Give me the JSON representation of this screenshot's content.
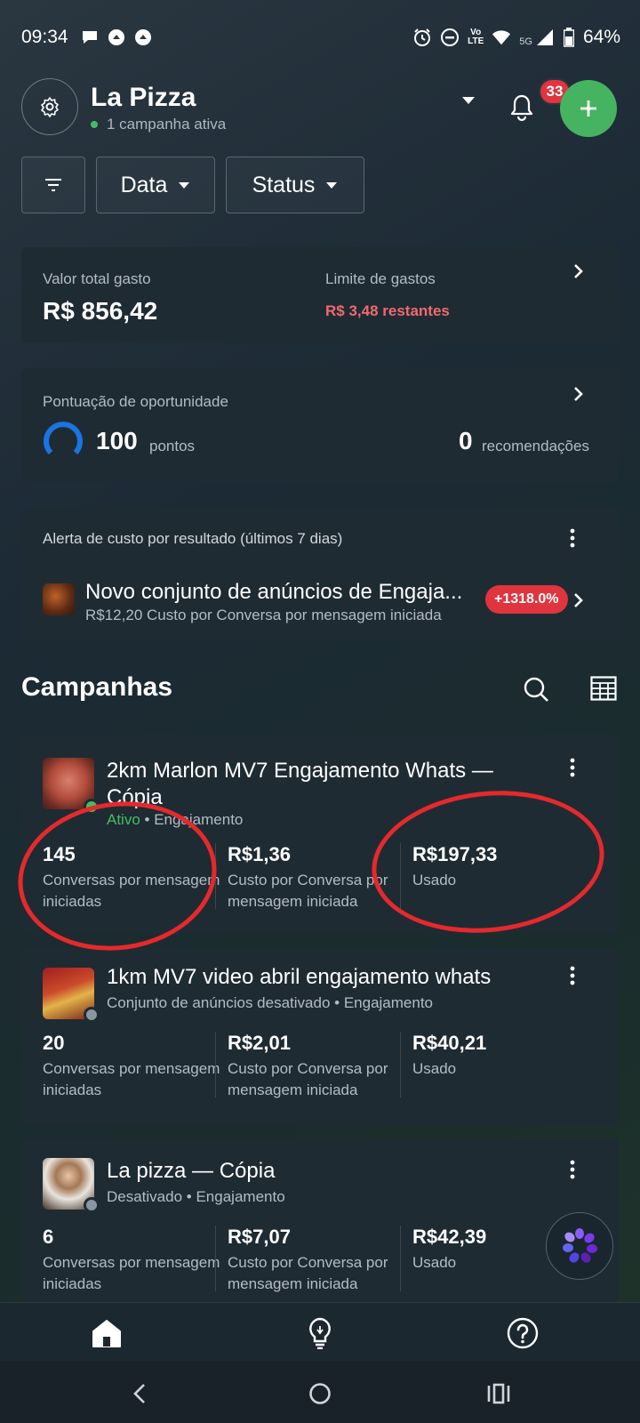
{
  "status_bar": {
    "time": "09:34",
    "battery": "64%",
    "network": "5G",
    "lte": "LTE"
  },
  "header": {
    "title": "La Pizza",
    "subtitle": "1 campanha ativa",
    "notification_count": "33"
  },
  "filters": {
    "date_label": "Data",
    "status_label": "Status"
  },
  "spend": {
    "total_label": "Valor total gasto",
    "total_value": "R$ 856,42",
    "limit_label": "Limite de gastos",
    "limit_value": "R$ 3,48 restantes"
  },
  "opportunity": {
    "label": "Pontuação de oportunidade",
    "score": "100",
    "score_unit": "pontos",
    "score_fraction": 1.0,
    "recommendations": "0",
    "recommendations_unit": "recomendações"
  },
  "alert": {
    "title": "Alerta de custo por resultado (últimos 7 dias)",
    "name": "Novo conjunto de anúncios de Engaja...",
    "meta": "R$12,20  Custo por Conversa por mensagem iniciada",
    "badge": "+1318.0%"
  },
  "campaigns_section": {
    "title": "Campanhas"
  },
  "campaigns": [
    {
      "name": "2km Marlon MV7 Engajamento Whats — Cópia",
      "status": "Ativo",
      "objective": "• Engajamento",
      "status_color": "#45bd62",
      "metrics": [
        {
          "value": "145",
          "label": "Conversas por mensagem iniciadas"
        },
        {
          "value": "R$1,36",
          "label": "Custo por Conversa por mensagem iniciada"
        },
        {
          "value": "R$197,33",
          "label": "Usado"
        }
      ]
    },
    {
      "name": "1km MV7 video abril engajamento whats",
      "status": "Conjunto de anúncios desativado",
      "objective": "• Engajamento",
      "status_color": "#8a96a0",
      "metrics": [
        {
          "value": "20",
          "label": "Conversas por mensagem iniciadas"
        },
        {
          "value": "R$2,01",
          "label": "Custo por Conversa por mensagem iniciada"
        },
        {
          "value": "R$40,21",
          "label": "Usado"
        }
      ]
    },
    {
      "name": "La pizza — Cópia",
      "status": "Desativado",
      "objective": "• Engajamento",
      "status_color": "#8a96a0",
      "metrics": [
        {
          "value": "6",
          "label": "Conversas por mensagem iniciadas"
        },
        {
          "value": "R$7,07",
          "label": "Custo por Conversa por mensagem iniciada"
        },
        {
          "value": "R$42,39",
          "label": "Usado"
        }
      ]
    }
  ],
  "colors": {
    "accent_green": "#45b35f",
    "alert_red": "#e0343f",
    "annotation_red": "#e5292c",
    "score_blue": "#1b74e4"
  }
}
